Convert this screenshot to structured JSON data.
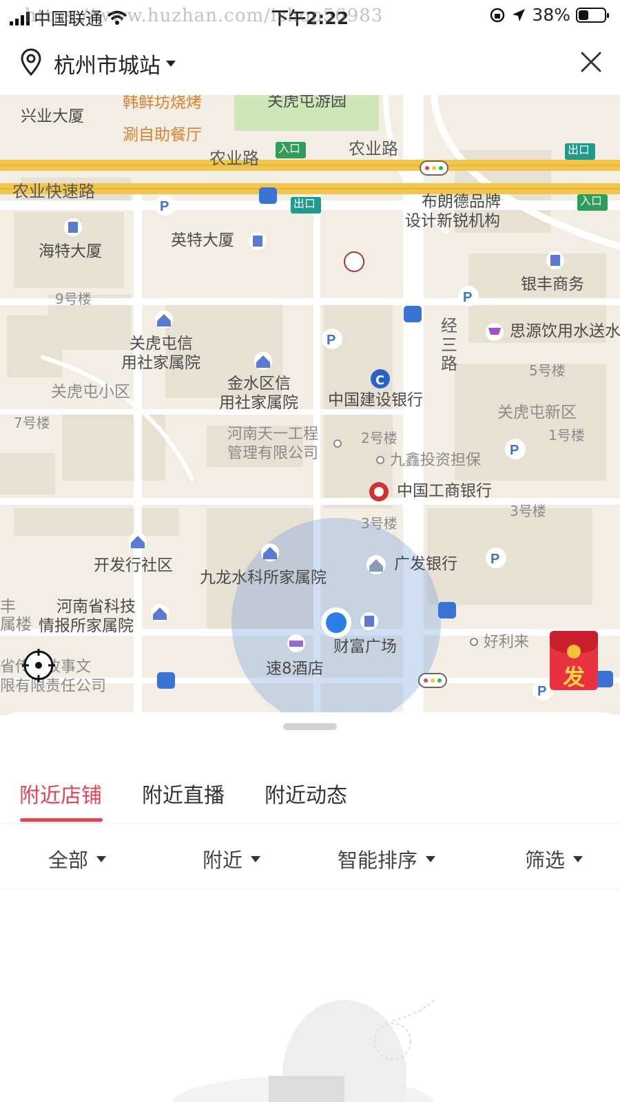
{
  "status_bar": {
    "carrier": "中国联通",
    "time": "下午2:22",
    "battery_percent": "38%",
    "battery_level": 0.38,
    "watermark": "https://www.huzhan.com/ishop56983"
  },
  "header": {
    "city_station": "杭州市城站"
  },
  "map": {
    "labels": {
      "xingye": "兴业大厦",
      "hanxianfang": "韩鲜坊烧烤",
      "hanxianfang2": "涮自助餐厅",
      "guanhuyouyuan": "关虎屯游园",
      "nongyelu1": "农业路",
      "nongyelu2": "农业路",
      "nongyekuaisu": "农业快速路",
      "rukou1": "入口",
      "chukou1": "出口",
      "chukou2": "出口",
      "rukou2": "入口",
      "bulangde1": "布朗德品牌",
      "bulangde2": "设计新锐机构",
      "haite": "海特大厦",
      "yingte": "英特大厦",
      "yinfeng": "银丰商务",
      "bldg9": "9号楼",
      "guanhutun1": "关虎屯信",
      "guanhutun2": "用社家属院",
      "siyuan": "思源饮用水送水",
      "jingsanlu": "经三路",
      "bldg5": "5号楼",
      "jinshui1": "金水区信",
      "jinshui2": "用社家属院",
      "guanhuxiaoqu": "关虎屯小区",
      "ccb": "中国建设银行",
      "guanhuxinqu": "关虎屯新区",
      "bldg7": "7号楼",
      "henantianyi1": "河南天一工程",
      "henantianyi2": "管理有限公司",
      "bldg2": "2号楼",
      "jiuxin": "九鑫投资担保",
      "bldg1": "1号楼",
      "icbc": "中国工商银行",
      "bldg3a": "3号楼",
      "bldg3b": "3号楼",
      "kaifaxing": "开发行社区",
      "jiulong": "九龙水科所家属院",
      "guangfa": "广发银行",
      "henansheng1": "河南省科技",
      "henansheng2": "情报所家属院",
      "caifu": "财富广场",
      "haolilai": "好利来",
      "su8": "速8酒店",
      "shengchuan1": "省传由故事文",
      "shengchuan2": "限有限责任公司",
      "feng": "丰",
      "shulou": "属楼"
    },
    "red_envelope_label": "发"
  },
  "sheet": {
    "tabs": [
      "附近店铺",
      "附近直播",
      "附近动态"
    ],
    "active_tab": "附近店铺",
    "filters": [
      "全部",
      "附近",
      "智能排序",
      "筛选"
    ]
  },
  "colors": {
    "accent": "#e54457",
    "highway": "#f2c54b",
    "map_bg": "#f3eee3",
    "location_circle": "rgba(120,160,220,0.35)"
  }
}
